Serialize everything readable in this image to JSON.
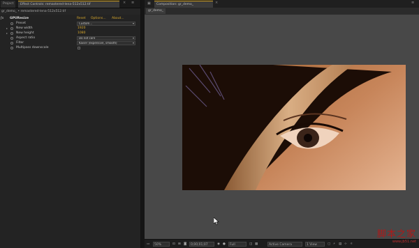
{
  "left_panel": {
    "tabs": [
      {
        "label": "Project"
      },
      {
        "label": "Effect Controls: remastered-lena-512x512.tif"
      }
    ],
    "menu_icon": "panel-menu-icon",
    "subline": "gr_demo_ • remastered-lena-512x512.tif",
    "effect": {
      "name": "GPUResize",
      "reset_label": "Reset",
      "options_label": "Options...",
      "about_label": "About..."
    },
    "properties": [
      {
        "label": "Preset",
        "type": "dropdown",
        "value": "Custom..."
      },
      {
        "label": "New width",
        "type": "number",
        "value": "1920"
      },
      {
        "label": "New height",
        "type": "number",
        "value": "1080"
      },
      {
        "label": "Aspect ratio",
        "type": "dropdown",
        "value": "Do not care"
      },
      {
        "label": "Filter",
        "type": "dropdown",
        "value": "Kaiser (expensive, smooth)"
      },
      {
        "label": "Multipass downscale",
        "type": "checkbox",
        "value": ""
      }
    ]
  },
  "comp_panel": {
    "tab_label": "Composition: gr_demo_",
    "sub_tab_label": "gr_demo_",
    "status": {
      "zoom": "50%",
      "timecode": "0;00;01;07",
      "resolution": "Full",
      "camera": "Active Camera",
      "view": "1 View"
    }
  },
  "watermark": {
    "title": "脚本之家",
    "url": "www.jb51.net"
  },
  "colors": {
    "accent": "#d9a92c",
    "panel_bg": "#232323",
    "viewer_bg": "#484848"
  }
}
